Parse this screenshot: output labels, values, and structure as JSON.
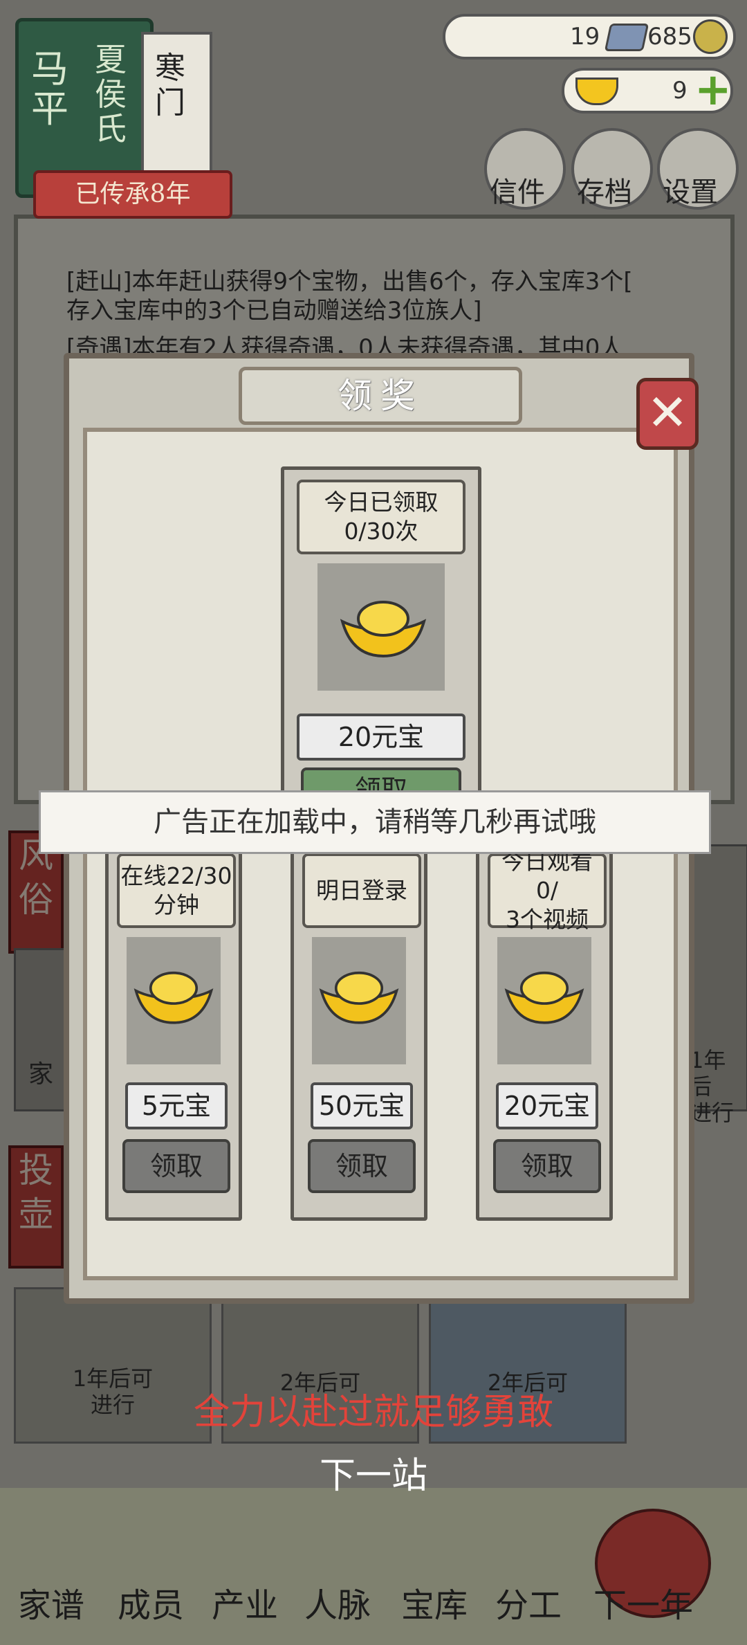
{
  "family": {
    "name_line1": "马平",
    "name_line2": "夏侯氏",
    "rank": "寒门",
    "inherit": "已传承8年"
  },
  "currency": {
    "silver": "19",
    "copper": "685",
    "gold": "9"
  },
  "top_buttons": [
    "信件",
    "存档",
    "设置"
  ],
  "log": {
    "line0": "[赶山]本年赶山获得9个宝物，出售6个，存入宝库3个[",
    "line1": "存入宝库中的3个已自动赠送给3位族人]",
    "line2": "[奇遇]本年有2人获得奇遇，0人未获得奇遇，其中0人"
  },
  "side_tabs": [
    "风俗",
    "投壶"
  ],
  "background_cards": {
    "left_card_text": "家",
    "right_card_text": "1年后\n进行",
    "bottom1": "1年后可\n进行",
    "bottom2": "2年后可",
    "bottom3": "2年后可"
  },
  "subtitle": {
    "line1": "全力以赴过就足够勇敢",
    "line2": "下一站"
  },
  "nav": [
    "家谱",
    "成员",
    "产业",
    "人脉",
    "宝库",
    "分工",
    "下一年"
  ],
  "popup": {
    "title": "领奖",
    "close_label": "✕",
    "top_card": {
      "head": "今日已领取\n0/30次",
      "amount": "20元宝",
      "claim": "领取"
    },
    "cards": [
      {
        "head": "在线22/30\n分钟",
        "amount": "5元宝",
        "claim": "领取"
      },
      {
        "head": "明日登录",
        "amount": "50元宝",
        "claim": "领取"
      },
      {
        "head": "今日观看0/\n3个视频",
        "amount": "20元宝",
        "claim": "领取"
      }
    ]
  },
  "toast": "广告正在加载中，请稍等几秒再试哦",
  "colors": {
    "accent_red": "#b8403b",
    "gold": "#f3c51f",
    "subtitle_red": "#e3433a"
  }
}
